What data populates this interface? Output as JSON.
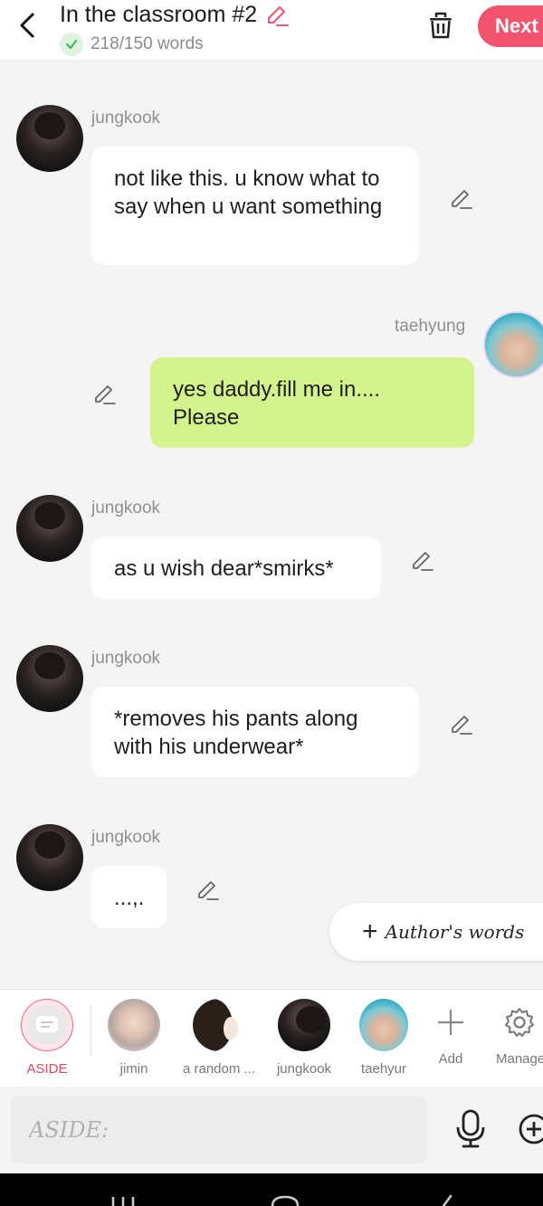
{
  "header": {
    "title": "In the classroom #2",
    "word_count": "218/150 words",
    "next_label": "Next"
  },
  "messages": [
    {
      "sender": "jungkook",
      "text": "not like this. u know what to say when u want something"
    },
    {
      "sender": "taehyung",
      "text": "yes daddy.fill me in.... Please"
    },
    {
      "sender": "jungkook",
      "text": "as u wish dear*smirks*"
    },
    {
      "sender": "jungkook",
      "text": "*removes his pants along with his underwear*"
    },
    {
      "sender": "jungkook",
      "text": "...,."
    }
  ],
  "author_words_label": "Author's words",
  "characters": [
    {
      "label": "ASIDE",
      "icon": "chat-bubble-icon"
    },
    {
      "label": "jimin"
    },
    {
      "label": "a random ..."
    },
    {
      "label": "jungkook"
    },
    {
      "label": "taehyur"
    },
    {
      "label": "Add",
      "icon": "plus-icon"
    },
    {
      "label": "Manage",
      "icon": "gear-icon"
    }
  ],
  "input": {
    "placeholder": "ASIDE:"
  },
  "colors": {
    "accent": "#f2546f",
    "aside_label": "#e0485a",
    "green_bubble": "#d4f38d",
    "check": "#3dbb5c"
  }
}
